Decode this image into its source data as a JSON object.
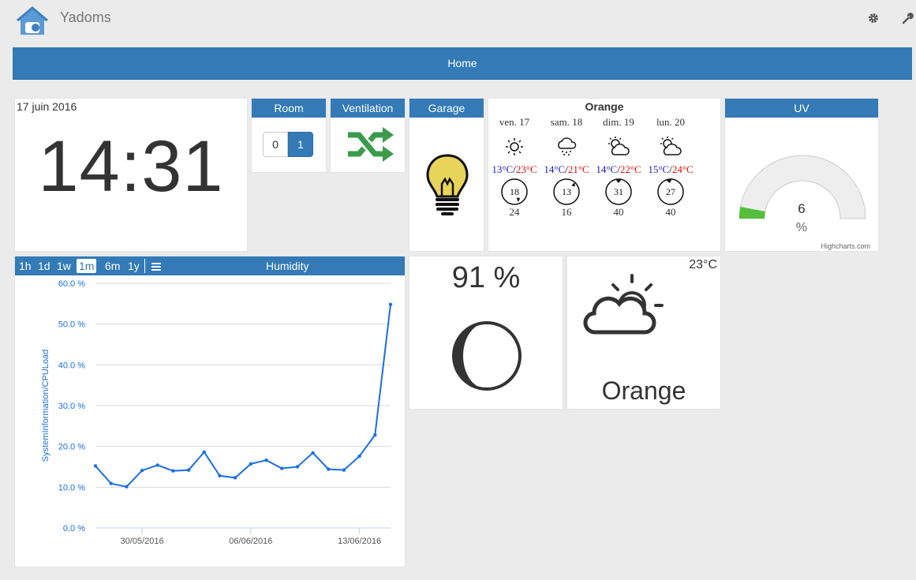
{
  "app": {
    "title": "Yadoms"
  },
  "nav": {
    "home_label": "Home"
  },
  "clock": {
    "date": "17 juin 2016",
    "time": "14:31"
  },
  "room": {
    "title": "Room",
    "options": [
      "0",
      "1"
    ],
    "selected": "1"
  },
  "ventilation": {
    "title": "Ventilation",
    "icon": "shuffle-icon",
    "color": "#3a9b4a"
  },
  "garage": {
    "title": "Garage",
    "icon": "lightbulb-icon",
    "bulb_color": "#e8d45a"
  },
  "forecast": {
    "title": "Orange",
    "days": [
      {
        "day": "ven. 17",
        "icon": "sun-icon",
        "low": "13°C",
        "high": "23°C",
        "wind_dir": "18",
        "wind_speed": "24"
      },
      {
        "day": "sam. 18",
        "icon": "snow-cloud-icon",
        "low": "14°C",
        "high": "21°C",
        "wind_dir": "13",
        "wind_speed": "16"
      },
      {
        "day": "dim. 19",
        "icon": "partly-cloudy-icon",
        "low": "14°C",
        "high": "22°C",
        "wind_dir": "31",
        "wind_speed": "40"
      },
      {
        "day": "lun. 20",
        "icon": "partly-cloudy-icon",
        "low": "15°C",
        "high": "24°C",
        "wind_dir": "27",
        "wind_speed": "40"
      }
    ],
    "separator": "/"
  },
  "uv": {
    "title": "UV",
    "value": "6",
    "unit": "%",
    "max": 100,
    "credit": "Highcharts.com",
    "fill_color": "#55bf3b"
  },
  "humidity_chart": {
    "ranges": [
      "1h",
      "1d",
      "1w",
      "1m",
      "6m",
      "1y"
    ],
    "selected_range": "1m",
    "menu_icon": "hamburger-menu-icon"
  },
  "chart_data": {
    "type": "line",
    "title": "Humidity",
    "ylabel": "SystemInformation/CPULoad",
    "ylim": [
      0,
      60
    ],
    "yticks": [
      "0.0 %",
      "10.0 %",
      "20.0 %",
      "30.0 %",
      "40.0 %",
      "50.0 %",
      "60.0 %"
    ],
    "xticks": [
      "30/05/2016",
      "06/06/2016",
      "13/06/2016"
    ],
    "xtick_dates": [
      "2016-05-30",
      "2016-06-06",
      "2016-06-13"
    ],
    "x": [
      "2016-05-27",
      "2016-05-28",
      "2016-05-29",
      "2016-05-30",
      "2016-05-31",
      "2016-06-01",
      "2016-06-02",
      "2016-06-03",
      "2016-06-04",
      "2016-06-05",
      "2016-06-06",
      "2016-06-07",
      "2016-06-08",
      "2016-06-09",
      "2016-06-10",
      "2016-06-11",
      "2016-06-12",
      "2016-06-13",
      "2016-06-14",
      "2016-06-15"
    ],
    "series": [
      {
        "values": [
          15.2,
          10.9,
          10.1,
          14.1,
          15.4,
          14.0,
          14.2,
          18.6,
          12.8,
          12.3,
          15.7,
          16.6,
          14.6,
          15.0,
          18.4,
          14.4,
          14.2,
          17.6,
          22.8,
          54.8
        ]
      }
    ],
    "grid": true,
    "color": "#1a6fe6"
  },
  "percent": {
    "value": "91 %",
    "icon": "moon-icon"
  },
  "weather": {
    "temperature": "23°C",
    "location": "Orange",
    "icon": "partly-cloudy-icon"
  }
}
